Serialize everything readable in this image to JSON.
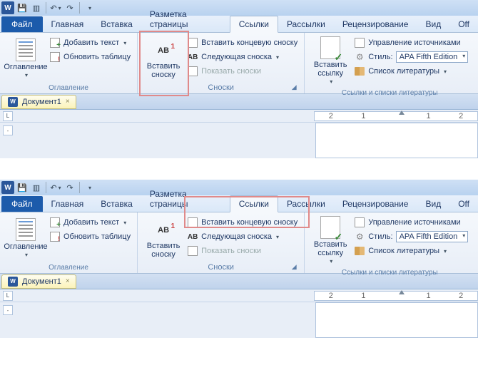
{
  "qat": {
    "word": "W"
  },
  "tabs": {
    "file": "Файл",
    "home": "Главная",
    "insert": "Вставка",
    "layout": "Разметка страницы",
    "references": "Ссылки",
    "mailings": "Рассылки",
    "review": "Рецензирование",
    "view": "Вид",
    "off": "Off"
  },
  "ribbon": {
    "toc": {
      "button": "Оглавление",
      "add_text": "Добавить текст",
      "update": "Обновить таблицу",
      "group": "Оглавление"
    },
    "footnotes": {
      "insert": "Вставить сноску",
      "ab": "AB",
      "ab_sup": "1",
      "endnote": "Вставить концевую сноску",
      "next": "Следующая сноска",
      "show": "Показать сноски",
      "group": "Сноски"
    },
    "citations": {
      "insert": "Вставить ссылку",
      "sources": "Управление источниками",
      "style_label": "Стиль:",
      "style_value": "APA Fifth Edition",
      "bibliography": "Список литературы",
      "group": "Ссылки и списки литературы"
    }
  },
  "doc": {
    "name": "Документ1",
    "ruler_left": "L",
    "ruler_ticks": [
      "2",
      "1",
      "",
      "1",
      "2"
    ]
  }
}
